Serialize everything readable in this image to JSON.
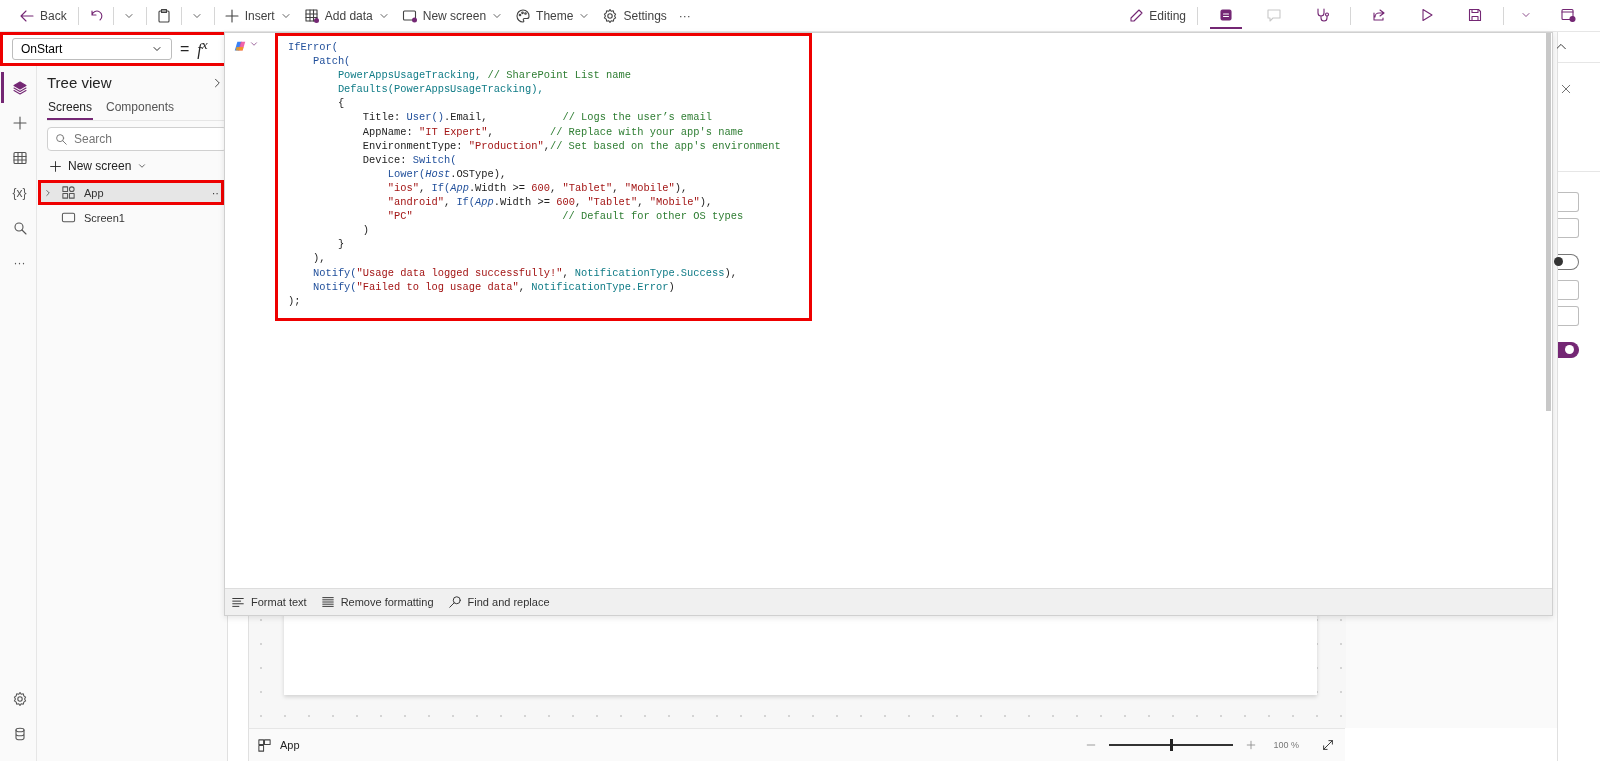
{
  "toolbar": {
    "back": "Back",
    "menus": [
      {
        "label": "Insert",
        "dropdown": true
      },
      {
        "label": "Add data",
        "dropdown": true
      },
      {
        "label": "New screen",
        "dropdown": true
      },
      {
        "label": "Theme",
        "dropdown": true
      },
      {
        "label": "Settings",
        "dropdown": false
      }
    ],
    "more": "···",
    "editing": "Editing",
    "right_buttons": [
      {
        "selected": true,
        "disabled": false
      },
      {
        "selected": false,
        "disabled": true
      },
      {
        "selected": false,
        "disabled": false
      },
      {
        "selected": false,
        "disabled": false
      },
      {
        "selected": false,
        "disabled": false
      },
      {
        "selected": false,
        "disabled": false
      }
    ]
  },
  "formula_bar": {
    "property": "OnStart",
    "highlighted": true,
    "equals": "=",
    "fx": "f$^{x}$"
  },
  "left_rail": {
    "items": [
      {
        "selected": true
      },
      {
        "selected": false
      },
      {
        "selected": false
      },
      {
        "selected": false,
        "label": "{x}"
      },
      {
        "selected": false
      },
      {
        "selected": false,
        "label": "···"
      }
    ]
  },
  "tree_view": {
    "title": "Tree view",
    "tabs": [
      {
        "label": "Screens",
        "selected": true
      },
      {
        "label": "Components",
        "selected": false
      }
    ],
    "search": {
      "placeholder": "Search"
    },
    "new_screen": "New screen",
    "items": [
      {
        "kind": "app",
        "label": "App",
        "selected": true,
        "highlighted": true,
        "more": "··"
      },
      {
        "kind": "screen",
        "label": "Screen1",
        "selected": false,
        "highlighted": false
      }
    ]
  },
  "code_editor": {
    "highlighted": true,
    "lines": [
      [
        {
          "kind": "fn",
          "text": "IfError("
        }
      ],
      [
        {
          "kind": "fn",
          "text": "    Patch("
        }
      ],
      [
        {
          "kind": "ident",
          "text": "        PowerAppsUsageTracking, "
        },
        {
          "kind": "comment",
          "text": "// SharePoint List name"
        }
      ],
      [
        {
          "kind": "ident",
          "text": "        Defaults(PowerAppsUsageTracking),"
        }
      ],
      [
        {
          "kind": "plain",
          "text": "        {"
        }
      ],
      [
        {
          "kind": "plain",
          "text": "            Title: "
        },
        {
          "kind": "fn",
          "text": "User()"
        },
        {
          "kind": "plain",
          "text": ".Email,            "
        },
        {
          "kind": "comment",
          "text": "// Logs the user’s email"
        }
      ],
      [
        {
          "kind": "plain",
          "text": "            AppName: "
        },
        {
          "kind": "string",
          "text": "\"IT Expert\""
        },
        {
          "kind": "plain",
          "text": ",         "
        },
        {
          "kind": "comment",
          "text": "// Replace with your app's name"
        }
      ],
      [
        {
          "kind": "plain",
          "text": "            EnvironmentType: "
        },
        {
          "kind": "string",
          "text": "\"Production\""
        },
        {
          "kind": "plain",
          "text": ","
        },
        {
          "kind": "comment",
          "text": "// Set based on the app's environment"
        }
      ],
      [
        {
          "kind": "plain",
          "text": "            Device: "
        },
        {
          "kind": "fn",
          "text": "Switch("
        }
      ],
      [
        {
          "kind": "fn",
          "text": "                Lower("
        },
        {
          "kind": "italic",
          "text": "Host"
        },
        {
          "kind": "plain",
          "text": ".OSType),"
        }
      ],
      [
        {
          "kind": "string",
          "text": "                \"ios\""
        },
        {
          "kind": "plain",
          "text": ", "
        },
        {
          "kind": "fn",
          "text": "If("
        },
        {
          "kind": "italic",
          "text": "App"
        },
        {
          "kind": "plain",
          "text": ".Width >= "
        },
        {
          "kind": "string",
          "text": "600"
        },
        {
          "kind": "plain",
          "text": ", "
        },
        {
          "kind": "string",
          "text": "\"Tablet\""
        },
        {
          "kind": "plain",
          "text": ", "
        },
        {
          "kind": "string",
          "text": "\"Mobile\""
        },
        {
          "kind": "plain",
          "text": "),"
        }
      ],
      [
        {
          "kind": "string",
          "text": "                \"android\""
        },
        {
          "kind": "plain",
          "text": ", "
        },
        {
          "kind": "fn",
          "text": "If("
        },
        {
          "kind": "italic",
          "text": "App"
        },
        {
          "kind": "plain",
          "text": ".Width >= "
        },
        {
          "kind": "string",
          "text": "600"
        },
        {
          "kind": "plain",
          "text": ", "
        },
        {
          "kind": "string",
          "text": "\"Tablet\""
        },
        {
          "kind": "plain",
          "text": ", "
        },
        {
          "kind": "string",
          "text": "\"Mobile\""
        },
        {
          "kind": "plain",
          "text": "),"
        }
      ],
      [
        {
          "kind": "string",
          "text": "                \"PC\"                        "
        },
        {
          "kind": "comment",
          "text": "// Default for other OS types"
        }
      ],
      [
        {
          "kind": "plain",
          "text": "            )"
        }
      ],
      [
        {
          "kind": "plain",
          "text": "        }"
        }
      ],
      [
        {
          "kind": "plain",
          "text": "    ),"
        }
      ],
      [
        {
          "kind": "fn",
          "text": "    Notify("
        },
        {
          "kind": "string",
          "text": "\"Usage data logged successfully!\""
        },
        {
          "kind": "plain",
          "text": ", "
        },
        {
          "kind": "ident",
          "text": "NotificationType.Success"
        },
        {
          "kind": "plain",
          "text": "),"
        }
      ],
      [
        {
          "kind": "fn",
          "text": "    Notify("
        },
        {
          "kind": "string",
          "text": "\"Failed to log usage data\""
        },
        {
          "kind": "plain",
          "text": ", "
        },
        {
          "kind": "ident",
          "text": "NotificationType.Error"
        },
        {
          "kind": "plain",
          "text": ")"
        }
      ],
      [
        {
          "kind": "plain",
          "text": ");"
        }
      ]
    ],
    "format_bar": [
      "Format text",
      "Remove formatting",
      "Find and replace"
    ]
  },
  "bottom_bar": {
    "label": "App",
    "zoom": {
      "level": 0.5,
      "reading": "100 %"
    }
  },
  "right_panel": {
    "controls": [
      {
        "kind": "input"
      },
      {
        "kind": "input"
      },
      {
        "kind": "toggle",
        "on": false
      },
      {
        "kind": "input"
      },
      {
        "kind": "input"
      },
      {
        "kind": "toggle",
        "on": true
      }
    ]
  }
}
